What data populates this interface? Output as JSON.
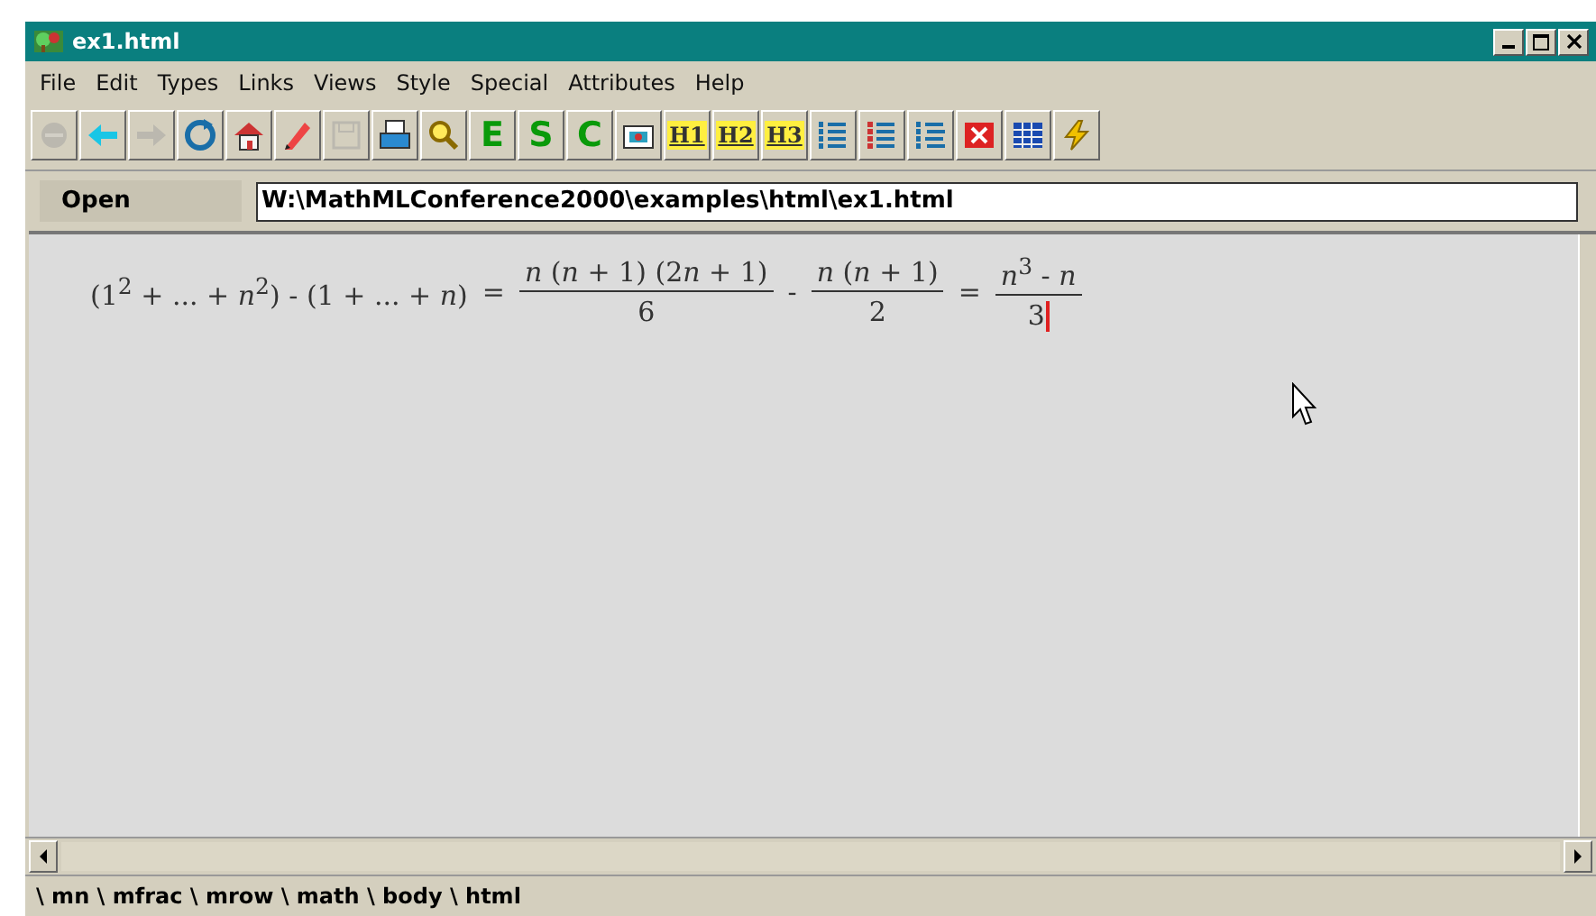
{
  "window": {
    "title": "ex1.html"
  },
  "menu": [
    "File",
    "Edit",
    "Types",
    "Links",
    "Views",
    "Style",
    "Special",
    "Attributes",
    "Help"
  ],
  "toolbar": [
    {
      "kind": "stop",
      "disabled": true
    },
    {
      "kind": "back",
      "disabled": false
    },
    {
      "kind": "forward",
      "disabled": true
    },
    {
      "kind": "reload",
      "disabled": false
    },
    {
      "kind": "home",
      "disabled": false
    },
    {
      "kind": "pencil",
      "disabled": false
    },
    {
      "kind": "save",
      "disabled": true
    },
    {
      "kind": "print",
      "disabled": false
    },
    {
      "kind": "find",
      "disabled": false
    },
    {
      "kind": "letter",
      "label": "E",
      "disabled": false
    },
    {
      "kind": "letter",
      "label": "S",
      "disabled": false
    },
    {
      "kind": "letter",
      "label": "C",
      "disabled": false
    },
    {
      "kind": "image",
      "disabled": false
    },
    {
      "kind": "heading",
      "label": "H1",
      "disabled": false
    },
    {
      "kind": "heading",
      "label": "H2",
      "disabled": false
    },
    {
      "kind": "heading",
      "label": "H3",
      "disabled": false
    },
    {
      "kind": "bullets",
      "disabled": false
    },
    {
      "kind": "numbers",
      "disabled": false
    },
    {
      "kind": "indent",
      "disabled": false
    },
    {
      "kind": "tag",
      "disabled": false
    },
    {
      "kind": "table",
      "disabled": false
    },
    {
      "kind": "bolt",
      "disabled": false
    }
  ],
  "open_bar": {
    "label": "Open",
    "value": "W:\\MathMLConference2000\\examples\\html\\ex1.html"
  },
  "formula": [
    {
      "kind": "text",
      "text": "(1$^{2}$ + ... + *n*$^{2}$) - (1 + ... + *n*)"
    },
    {
      "kind": "op",
      "text": "="
    },
    {
      "kind": "fraction",
      "numerator": "*n* (*n* + 1) (2𝑛 + 1)",
      "denominator": "6"
    },
    {
      "kind": "op",
      "text": "-"
    },
    {
      "kind": "fraction",
      "numerator": "*n* (*n* + 1)",
      "denominator": "2"
    },
    {
      "kind": "op",
      "text": "="
    },
    {
      "kind": "fraction",
      "numerator": "*n*$^{3}$ - *n*",
      "denominator": "3"
    }
  ],
  "status_bar": "\\ mn \\ mfrac \\ mrow \\ math \\ body \\ html"
}
